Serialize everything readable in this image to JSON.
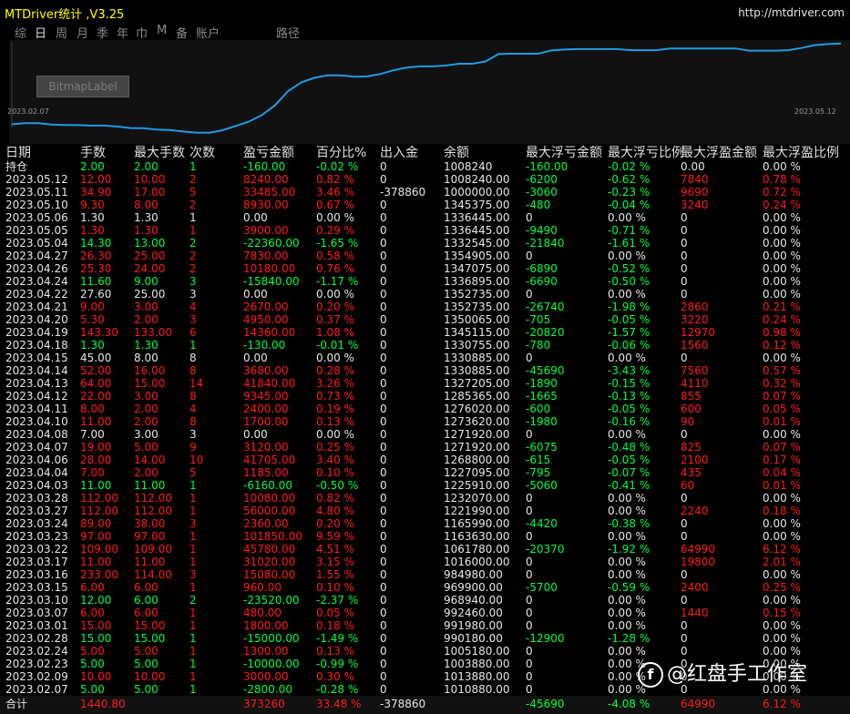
{
  "title": "MTDriver统计 ,V3.25",
  "url": "http://mtdriver.com",
  "tabs": [
    "综",
    "日",
    "周",
    "月",
    "季",
    "年",
    "巾",
    "M",
    "备",
    "账户",
    "路径"
  ],
  "selected_tab": "日",
  "bitmap_label": "BitmapLabel",
  "chart_start_label": "2023.02.07",
  "chart_end_label": "2023.05.12",
  "headers": [
    "日期",
    "手数",
    "最大手数",
    "次数",
    "盈亏金额",
    "百分比%",
    "出入金",
    "余额",
    "最大浮亏金额",
    "最大浮亏比例",
    "最大浮盈金额",
    "最大浮盈比例"
  ],
  "rows": [
    [
      "持仓",
      "2.00",
      "2.00",
      "1",
      "-160.00",
      "-0.02 %",
      "0",
      "1008240",
      "-160.00",
      "-0.02 %",
      "0.00",
      "0.00 %"
    ],
    [
      "2023.05.12",
      "12.00",
      "10.00",
      "2",
      "8240.00",
      "0.82 %",
      "0",
      "1008240.00",
      "-6200",
      "-0.62 %",
      "7840",
      "0.78 %"
    ],
    [
      "2023.05.11",
      "34.90",
      "17.00",
      "5",
      "33485.00",
      "3.46 %",
      "-378860",
      "1000000.00",
      "-3060",
      "-0.23 %",
      "9690",
      "0.72 %"
    ],
    [
      "2023.05.10",
      "9.30",
      "8.00",
      "2",
      "8930.00",
      "0.67 %",
      "0",
      "1345375.00",
      "-480",
      "-0.04 %",
      "3240",
      "0.24 %"
    ],
    [
      "2023.05.06",
      "1.30",
      "1.30",
      "1",
      "0.00",
      "0.00 %",
      "0",
      "1336445.00",
      "0",
      "0.00 %",
      "0",
      "0.00 %"
    ],
    [
      "2023.05.05",
      "1.30",
      "1.30",
      "1",
      "3900.00",
      "0.29 %",
      "0",
      "1336445.00",
      "-9490",
      "-0.71 %",
      "0",
      "0.00 %"
    ],
    [
      "2023.05.04",
      "14.30",
      "13.00",
      "2",
      "-22360.00",
      "-1.65 %",
      "0",
      "1332545.00",
      "-21840",
      "-1.61 %",
      "0",
      "0.00 %"
    ],
    [
      "2023.04.27",
      "26.30",
      "25.00",
      "2",
      "7830.00",
      "0.58 %",
      "0",
      "1354905.00",
      "0",
      "0.00 %",
      "0",
      "0.00 %"
    ],
    [
      "2023.04.26",
      "25.30",
      "24.00",
      "2",
      "10180.00",
      "0.76 %",
      "0",
      "1347075.00",
      "-6890",
      "-0.52 %",
      "0",
      "0.00 %"
    ],
    [
      "2023.04.24",
      "11.60",
      "9.00",
      "3",
      "-15840.00",
      "-1.17 %",
      "0",
      "1336895.00",
      "-6690",
      "-0.50 %",
      "0",
      "0.00 %"
    ],
    [
      "2023.04.22",
      "27.60",
      "25.00",
      "3",
      "0.00",
      "0.00 %",
      "0",
      "1352735.00",
      "0",
      "0.00 %",
      "0",
      "0.00 %"
    ],
    [
      "2023.04.21",
      "9.00",
      "3.00",
      "4",
      "2670.00",
      "0.20 %",
      "0",
      "1352735.00",
      "-26740",
      "-1.98 %",
      "2860",
      "0.21 %"
    ],
    [
      "2023.04.20",
      "5.30",
      "2.00",
      "3",
      "4950.00",
      "0.37 %",
      "0",
      "1350065.00",
      "-705",
      "-0.05 %",
      "3220",
      "0.24 %"
    ],
    [
      "2023.04.19",
      "143.30",
      "133.00",
      "6",
      "14360.00",
      "1.08 %",
      "0",
      "1345115.00",
      "-20820",
      "-1.57 %",
      "12970",
      "0.98 %"
    ],
    [
      "2023.04.18",
      "1.30",
      "1.30",
      "1",
      "-130.00",
      "-0.01 %",
      "0",
      "1330755.00",
      "-780",
      "-0.06 %",
      "1560",
      "0.12 %"
    ],
    [
      "2023.04.15",
      "45.00",
      "8.00",
      "8",
      "0.00",
      "0.00 %",
      "0",
      "1330885.00",
      "0",
      "0.00 %",
      "0",
      "0.00 %"
    ],
    [
      "2023.04.14",
      "52.00",
      "16.00",
      "8",
      "3680.00",
      "0.28 %",
      "0",
      "1330885.00",
      "-45690",
      "-3.43 %",
      "7560",
      "0.57 %"
    ],
    [
      "2023.04.13",
      "64.00",
      "15.00",
      "14",
      "41840.00",
      "3.26 %",
      "0",
      "1327205.00",
      "-1890",
      "-0.15 %",
      "4110",
      "0.32 %"
    ],
    [
      "2023.04.12",
      "22.00",
      "3.00",
      "8",
      "9345.00",
      "0.73 %",
      "0",
      "1285365.00",
      "-1665",
      "-0.13 %",
      "855",
      "0.07 %"
    ],
    [
      "2023.04.11",
      "8.00",
      "2.00",
      "4",
      "2400.00",
      "0.19 %",
      "0",
      "1276020.00",
      "-600",
      "-0.05 %",
      "600",
      "0.05 %"
    ],
    [
      "2023.04.10",
      "11.00",
      "2.00",
      "8",
      "1700.00",
      "0.13 %",
      "0",
      "1273620.00",
      "-1980",
      "-0.16 %",
      "90",
      "0.01 %"
    ],
    [
      "2023.04.08",
      "7.00",
      "3.00",
      "3",
      "0.00",
      "0.00 %",
      "0",
      "1271920.00",
      "0",
      "0.00 %",
      "0",
      "0.00 %"
    ],
    [
      "2023.04.07",
      "19.00",
      "5.00",
      "9",
      "3120.00",
      "0.25 %",
      "0",
      "1271920.00",
      "-6075",
      "-0.48 %",
      "825",
      "0.07 %"
    ],
    [
      "2023.04.06",
      "28.00",
      "14.00",
      "10",
      "41705.00",
      "3.40 %",
      "0",
      "1268800.00",
      "-615",
      "-0.05 %",
      "2100",
      "0.17 %"
    ],
    [
      "2023.04.04",
      "7.00",
      "2.00",
      "5",
      "1185.00",
      "0.10 %",
      "0",
      "1227095.00",
      "-795",
      "-0.07 %",
      "435",
      "0.04 %"
    ],
    [
      "2023.04.03",
      "11.00",
      "11.00",
      "1",
      "-6160.00",
      "-0.50 %",
      "0",
      "1225910.00",
      "-5060",
      "-0.41 %",
      "60",
      "0.01 %"
    ],
    [
      "2023.03.28",
      "112.00",
      "112.00",
      "1",
      "10080.00",
      "0.82 %",
      "0",
      "1232070.00",
      "0",
      "0.00 %",
      "0",
      "0.00 %"
    ],
    [
      "2023.03.27",
      "112.00",
      "112.00",
      "1",
      "56000.00",
      "4.80 %",
      "0",
      "1221990.00",
      "0",
      "0.00 %",
      "2240",
      "0.18 %"
    ],
    [
      "2023.03.24",
      "89.00",
      "38.00",
      "3",
      "2360.00",
      "0.20 %",
      "0",
      "1165990.00",
      "-4420",
      "-0.38 %",
      "0",
      "0.00 %"
    ],
    [
      "2023.03.23",
      "97.00",
      "97.00",
      "1",
      "101850.00",
      "9.59 %",
      "0",
      "1163630.00",
      "0",
      "0.00 %",
      "0",
      "0.00 %"
    ],
    [
      "2023.03.22",
      "109.00",
      "109.00",
      "1",
      "45780.00",
      "4.51 %",
      "0",
      "1061780.00",
      "-20370",
      "-1.92 %",
      "64990",
      "6.12 %"
    ],
    [
      "2023.03.17",
      "11.00",
      "11.00",
      "1",
      "31020.00",
      "3.15 %",
      "0",
      "1016000.00",
      "0",
      "0.00 %",
      "19800",
      "2.01 %"
    ],
    [
      "2023.03.16",
      "233.00",
      "114.00",
      "3",
      "15080.00",
      "1.55 %",
      "0",
      "984980.00",
      "0",
      "0.00 %",
      "0",
      "0.00 %"
    ],
    [
      "2023.03.15",
      "6.00",
      "6.00",
      "1",
      "960.00",
      "0.10 %",
      "0",
      "969900.00",
      "-5700",
      "-0.59 %",
      "2400",
      "0.25 %"
    ],
    [
      "2023.03.10",
      "12.00",
      "6.00",
      "2",
      "-23520.00",
      "-2.37 %",
      "0",
      "968940.00",
      "0",
      "0.00 %",
      "0",
      "0.00 %"
    ],
    [
      "2023.03.07",
      "6.00",
      "6.00",
      "1",
      "480.00",
      "0.05 %",
      "0",
      "992460.00",
      "0",
      "0.00 %",
      "1440",
      "0.15 %"
    ],
    [
      "2023.03.01",
      "15.00",
      "15.00",
      "1",
      "1800.00",
      "0.18 %",
      "0",
      "991980.00",
      "0",
      "0.00 %",
      "0",
      "0.00 %"
    ],
    [
      "2023.02.28",
      "15.00",
      "15.00",
      "1",
      "-15000.00",
      "-1.49 %",
      "0",
      "990180.00",
      "-12900",
      "-1.28 %",
      "0",
      "0.00 %"
    ],
    [
      "2023.02.24",
      "5.00",
      "5.00",
      "1",
      "1300.00",
      "0.13 %",
      "0",
      "1005180.00",
      "0",
      "0.00 %",
      "0",
      "0.00 %"
    ],
    [
      "2023.02.23",
      "5.00",
      "5.00",
      "1",
      "-10000.00",
      "-0.99 %",
      "0",
      "1003880.00",
      "0",
      "0.00 %",
      "0",
      "0.00 %"
    ],
    [
      "2023.02.09",
      "10.00",
      "10.00",
      "1",
      "3000.00",
      "0.30 %",
      "0",
      "1013880.00",
      "0",
      "0.00 %",
      "0",
      "0.00 %"
    ],
    [
      "2023.02.07",
      "5.00",
      "5.00",
      "1",
      "-2800.00",
      "-0.28 %",
      "0",
      "1010880.00",
      "0",
      "0.00 %",
      "0",
      "0.00 %"
    ]
  ],
  "total": [
    "合计",
    "1440.80",
    "",
    "",
    "373260",
    "33.48 %",
    "-378860",
    "",
    "-45690",
    "-4.08 %",
    "64990",
    "6.12 %"
  ],
  "watermark": "@红盘手工作室",
  "watermark_logo": "f",
  "colors": {
    "profit": "#ff1a1a",
    "loss": "#00ff3c",
    "neutral": "#e6e6e6",
    "title": "#ffff00",
    "chart_line": "#1e9be6"
  },
  "chart_data": {
    "type": "line",
    "x_start": "2023.02.07",
    "x_end": "2023.05.12",
    "values": [
      1008000,
      1013000,
      1013000,
      1007000,
      1005000,
      1004000,
      1002000,
      1002000,
      998000,
      991000,
      990000,
      984000,
      982000,
      975000,
      970000,
      969000,
      981000,
      1000000,
      1020000,
      1050000,
      1095000,
      1160000,
      1200000,
      1221000,
      1232000,
      1232000,
      1226000,
      1227000,
      1238000,
      1255000,
      1268000,
      1273000,
      1273000,
      1277000,
      1285000,
      1285000,
      1296000,
      1330000,
      1331000,
      1331000,
      1331000,
      1346000,
      1350000,
      1352000,
      1352000,
      1352000,
      1352000,
      1347000,
      1347000,
      1347000,
      1355000,
      1355000,
      1355000,
      1355000,
      1355000,
      1355000,
      1345000,
      1345000,
      1345000,
      1347000,
      1357000,
      1370000,
      1375000,
      1378000
    ],
    "grid": false
  }
}
